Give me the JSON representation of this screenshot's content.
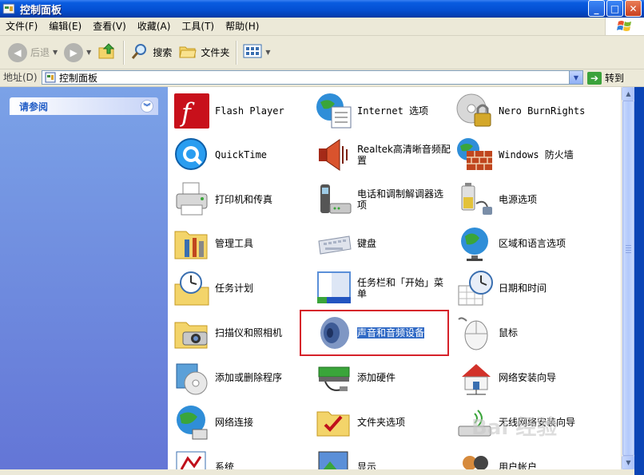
{
  "window": {
    "title": "控制面板"
  },
  "menu": [
    "文件(F)",
    "编辑(E)",
    "查看(V)",
    "收藏(A)",
    "工具(T)",
    "帮助(H)"
  ],
  "toolbar": {
    "back": "后退",
    "search": "搜索",
    "folders": "文件夹"
  },
  "address": {
    "label": "地址(D)",
    "value": "控制面板",
    "go": "转到"
  },
  "taskpane": {
    "see_also": "请参阅"
  },
  "items": [
    {
      "label": "Flash Player",
      "icon": "flash-player-icon"
    },
    {
      "label": "Internet 选项",
      "icon": "internet-options-icon"
    },
    {
      "label": "Nero BurnRights",
      "icon": "nero-burnrights-icon"
    },
    {
      "label": "QuickTime",
      "icon": "quicktime-icon"
    },
    {
      "label": "Realtek高清晰音频配置",
      "icon": "realtek-audio-icon"
    },
    {
      "label": "Windows 防火墙",
      "icon": "windows-firewall-icon"
    },
    {
      "label": "打印机和传真",
      "icon": "printers-faxes-icon"
    },
    {
      "label": "电话和调制解调器选项",
      "icon": "phone-modem-icon"
    },
    {
      "label": "电源选项",
      "icon": "power-options-icon"
    },
    {
      "label": "管理工具",
      "icon": "admin-tools-icon"
    },
    {
      "label": "键盘",
      "icon": "keyboard-icon"
    },
    {
      "label": "区域和语言选项",
      "icon": "regional-language-icon"
    },
    {
      "label": "任务计划",
      "icon": "scheduled-tasks-icon"
    },
    {
      "label": "任务栏和「开始」菜单",
      "icon": "taskbar-start-menu-icon"
    },
    {
      "label": "日期和时间",
      "icon": "date-time-icon"
    },
    {
      "label": "扫描仪和照相机",
      "icon": "scanners-cameras-icon"
    },
    {
      "label": "声音和音频设备",
      "icon": "sounds-audio-icon"
    },
    {
      "label": "鼠标",
      "icon": "mouse-icon"
    },
    {
      "label": "添加或删除程序",
      "icon": "add-remove-programs-icon"
    },
    {
      "label": "添加硬件",
      "icon": "add-hardware-icon"
    },
    {
      "label": "网络安装向导",
      "icon": "network-setup-wizard-icon"
    },
    {
      "label": "网络连接",
      "icon": "network-connections-icon"
    },
    {
      "label": "文件夹选项",
      "icon": "folder-options-icon"
    },
    {
      "label": "无线网络安装向导",
      "icon": "wireless-network-wizard-icon"
    },
    {
      "label": "系统",
      "icon": "system-icon"
    },
    {
      "label": "显示",
      "icon": "display-icon"
    },
    {
      "label": "用户帐户",
      "icon": "user-accounts-icon"
    }
  ],
  "watermark": "Bai 经验"
}
